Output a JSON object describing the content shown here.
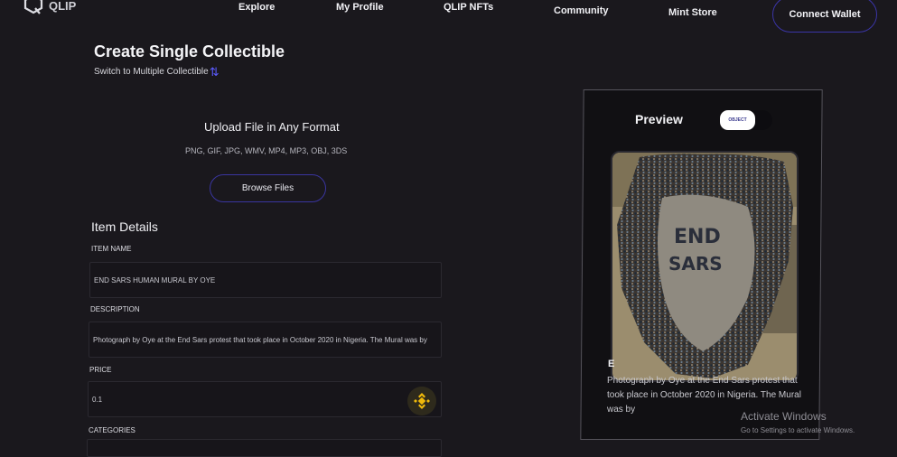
{
  "header": {
    "logo_text": "QLIP",
    "nav": [
      "Explore",
      "My Profile",
      "QLIP NFTs",
      "Community",
      "Mint Store"
    ],
    "connect_label": "Connect Wallet"
  },
  "form": {
    "title": "Create Single Collectible",
    "switch_label": "Switch to Multiple Collectible",
    "switch_icon": "swap-icon",
    "upload_title": "Upload File in Any Format",
    "upload_formats": "PNG, GIF, JPG, WMV, MP4, MP3, OBJ, 3DS",
    "browse_label": "Browse Files",
    "section_title": "Item Details",
    "fields": {
      "item_name_label": "ITEM NAME",
      "item_name_value": "END SARS HUMAN MURAL BY OYE",
      "description_label": "DESCRIPTION",
      "description_value": "Photograph by Oye at the End Sars protest  that took place in October 2020 in Nigeria. The Mural was by",
      "price_label": "PRICE",
      "price_value": "0.1",
      "categories_label": "CATEGORIES"
    }
  },
  "preview": {
    "title": "Preview",
    "object_label": "OBJECT",
    "initial": "E",
    "description": "Photograph by Oye at the End Sars protest that took place in October 2020 in Nigeria. The Mural was by",
    "image_text_1": "END",
    "image_text_2": "SARS"
  },
  "watermark": {
    "title": "Activate Windows",
    "subtitle": "Go to Settings to activate Windows."
  },
  "colors": {
    "background": "#1a181d",
    "accent_border": "#3b35a8",
    "bnb_gold": "#f0b90b"
  }
}
